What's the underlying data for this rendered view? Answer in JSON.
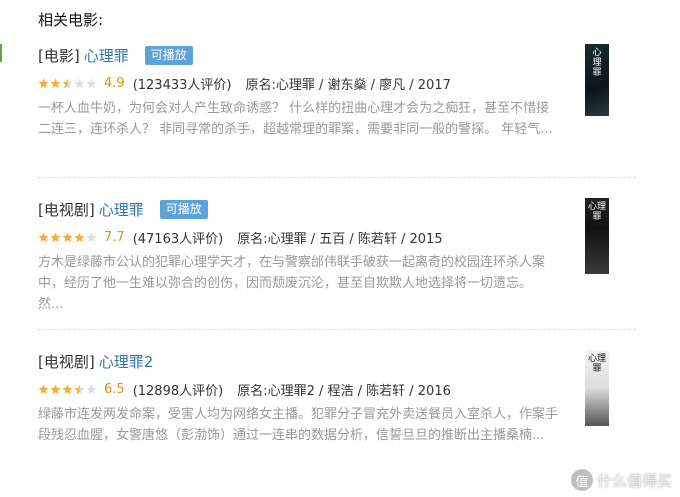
{
  "section": {
    "title": "相关电影:"
  },
  "colors": {
    "link": "#3377aa",
    "badge": "#5ea3d8",
    "score": "#e09015",
    "star": "#ffac2d"
  },
  "items": [
    {
      "type": "[电影]",
      "name": "心理罪",
      "badge": "可播放",
      "stars_filled": 2.5,
      "score": "4.9",
      "votes": "(123433人评价)",
      "info": "原名:心理罪 / 谢东燊 / 廖凡 / 2017",
      "desc": "一杯人血牛奶，为何会对人产生致命诱惑？ 什么样的扭曲心理才会为之痴狂，甚至不惜接二连三，连环杀人？ 非同寻常的杀手，超越常理的罪案，需要非同一般的警探。 年轻气...",
      "poster_text": "心 理 罪"
    },
    {
      "type": "[电视剧]",
      "name": "心理罪",
      "badge": "可播放",
      "stars_filled": 4,
      "score": "7.7",
      "votes": "(47163人评价)",
      "info": "原名:心理罪 / 五百 / 陈若轩 / 2015",
      "desc": "方木是绿藤市公认的犯罪心理学天才，在与警察邰伟联手破获一起离奇的校园连环杀人案中，经历了他一生难以弥合的创伤，因而颓废沉沦，甚至自欺欺人地选择将一切遗忘。 然...",
      "poster_text": "心理罪"
    },
    {
      "type": "[电视剧]",
      "name": "心理罪2",
      "badge": "",
      "stars_filled": 3.5,
      "score": "6.5",
      "votes": "(12898人评价)",
      "info": "原名:心理罪2 / 程浩 / 陈若轩 / 2016",
      "desc": "绿藤市连发两发命案，受害人均为网络女主播。犯罪分子冒充外卖送餐员入室杀人，作案手段残忍血腥，女警唐悠（彭渤饰）通过一连串的数据分析，信誓旦旦的推断出主播桑楠...",
      "poster_text": "心理罪"
    }
  ],
  "watermark": {
    "icon": "值",
    "text": "什么值得买"
  }
}
